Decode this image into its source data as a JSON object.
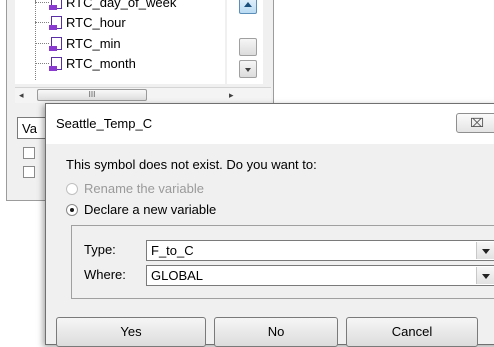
{
  "tree": {
    "items": [
      {
        "label": "RTC_day_of_week"
      },
      {
        "label": "RTC_hour"
      },
      {
        "label": "RTC_min"
      },
      {
        "label": "RTC_month"
      }
    ],
    "hscroll_thumb": "III"
  },
  "background": {
    "field_value": "Va"
  },
  "dialog": {
    "title": "Seattle_Temp_C",
    "close_label": "⌧",
    "message": "This symbol does not exist. Do you want to:",
    "options": [
      {
        "label": "Rename the variable",
        "enabled": false,
        "checked": false
      },
      {
        "label": "Declare a new variable",
        "enabled": true,
        "checked": true
      }
    ],
    "type_label": "Type:",
    "type_value": "F_to_C",
    "where_label": "Where:",
    "where_value": "GLOBAL",
    "buttons": {
      "yes": "Yes",
      "no": "No",
      "cancel": "Cancel"
    }
  },
  "icons": {
    "tree_item": "variable-doc-icon",
    "scroll_up": "scroll-up-arrow-icon",
    "scroll_down": "scroll-down-arrow-icon",
    "combo_arrow": "chevron-down-icon",
    "close": "close-icon"
  },
  "colors": {
    "dialog_bg": "#f0f0f0",
    "titlebar_bg": "#ffffff",
    "icon_purple": "#8a3ad0",
    "scroll_accent": "#b9dbf3"
  }
}
